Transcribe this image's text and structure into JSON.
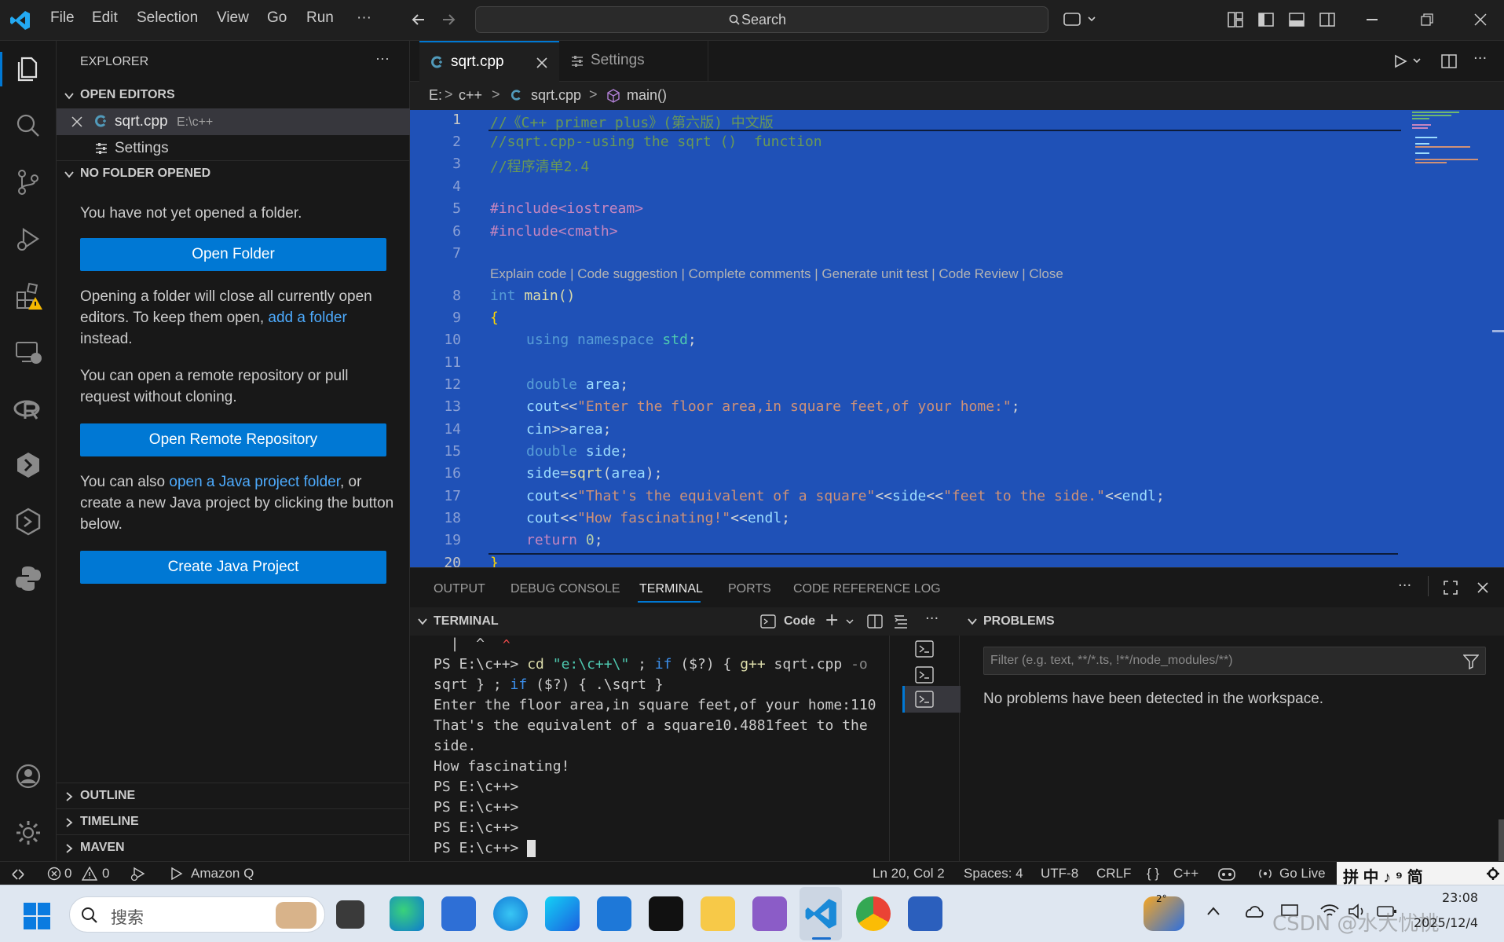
{
  "titlebar": {
    "menu": [
      "File",
      "Edit",
      "Selection",
      "View",
      "Go",
      "Run",
      "···"
    ],
    "search_placeholder": "Search"
  },
  "explorer": {
    "title": "EXPLORER",
    "open_editors": "OPEN EDITORS",
    "editors": [
      {
        "name": "sqrt.cpp",
        "path": "E:\\c++"
      },
      {
        "name": "Settings",
        "path": ""
      }
    ],
    "no_folder": "NO FOLDER OPENED",
    "not_opened": "You have not yet opened a folder.",
    "open_folder_btn": "Open Folder",
    "closing_text_1": "Opening a folder will close all currently open editors. To keep them open, ",
    "add_folder_link": "add a folder",
    "closing_text_2": " instead.",
    "remote_text": "You can open a remote repository or pull request without cloning.",
    "open_remote_btn": "Open Remote Repository",
    "java_text_1": "You can also ",
    "java_link": "open a Java project folder",
    "java_text_2": ", or create a new Java project by clicking the button below.",
    "create_java_btn": "Create Java Project",
    "outline": "OUTLINE",
    "timeline": "TIMELINE",
    "maven": "MAVEN"
  },
  "tabs": [
    {
      "label": "sqrt.cpp"
    },
    {
      "label": "Settings"
    }
  ],
  "breadcrumb": [
    "E:",
    "c++",
    "sqrt.cpp",
    "main()"
  ],
  "codelens": "Explain code | Code suggestion | Complete comments | Generate unit test | Code Review | Close",
  "line_numbers": [
    "1",
    "2",
    "3",
    "4",
    "5",
    "6",
    "7",
    "8",
    "9",
    "10",
    "11",
    "12",
    "13",
    "14",
    "15",
    "16",
    "17",
    "18",
    "19",
    "20"
  ],
  "code": {
    "l1": "//《C++ primer plus》(第六版) 中文版",
    "l2": "//sqrt.cpp--using the sqrt ()  function",
    "l3": "//程序清单2.4",
    "l5": "#include<iostream>",
    "l6": "#include<cmath>",
    "l8a": "int",
    "l8b": " main()",
    "l9": "{",
    "l10a": "using",
    "l10b": " namespace",
    "l10c": " std",
    "l10d": ";",
    "l12a": "double",
    "l12b": " area",
    "l12c": ";",
    "l13a": "cout",
    "l13b": "<<",
    "l13c": "\"Enter the floor area,in square feet,of your home:\"",
    "l13d": ";",
    "l14a": "cin",
    "l14b": ">>",
    "l14c": "area",
    "l14d": ";",
    "l15a": "double",
    "l15b": " side",
    "l15c": ";",
    "l16a": "side",
    "l16b": "=",
    "l16c": "sqrt",
    "l16d": "(",
    "l16e": "area",
    "l16f": ");",
    "l17a": "cout",
    "l17b": "<<",
    "l17c": "\"That's the equivalent of a square\"",
    "l17d": "<<",
    "l17e": "side",
    "l17f": "<<",
    "l17g": "\"feet to the side.\"",
    "l17h": "<<",
    "l17i": "endl",
    "l17j": ";",
    "l18a": "cout",
    "l18b": "<<",
    "l18c": "\"How fascinating!\"",
    "l18d": "<<",
    "l18e": "endl",
    "l18f": ";",
    "l19a": "return",
    "l19b": " 0",
    "l19c": ";",
    "l20": "}"
  },
  "panel": {
    "tabs": [
      "OUTPUT",
      "DEBUG CONSOLE",
      "TERMINAL",
      "PORTS",
      "CODE REFERENCE LOG"
    ],
    "terminal_title": "TERMINAL",
    "terminal_profile": "Code",
    "problems_title": "PROBLEMS",
    "filter_placeholder": "Filter (e.g. text, **/*.ts, !**/node_modules/**)",
    "no_problems": "No problems have been detected in the workspace.",
    "terminal_lines": {
      "caret": "  |  ^",
      "cmd_prompt": "PS E:\\c++> ",
      "cmd_cd": "cd",
      "cmd_path": " \"e:\\c++\\\"",
      "cmd_rest1": " ; ",
      "cmd_if": "if",
      "cmd_rest2": " ($?) { ",
      "cmd_gpp": "g++",
      "cmd_rest3": " sqrt.cpp ",
      "cmd_o": "-o",
      "cmd2_a": "sqrt } ; ",
      "cmd2_if": "if",
      "cmd2_b": " ($?) { .\\sqrt }",
      "out1": "Enter the floor area,in square feet,of your home:110",
      "out2": "That's the equivalent of a square10.4881feet to the",
      "out3": "side.",
      "out4": "How fascinating!",
      "ps1": "PS E:\\c++>",
      "ps2": "PS E:\\c++>",
      "ps3": "PS E:\\c++>",
      "ps4": "PS E:\\c++> "
    }
  },
  "status": {
    "errors": "0",
    "warnings": "0",
    "amazon_q": "Amazon Q",
    "position": "Ln 20, Col 2",
    "spaces": "Spaces: 4",
    "encoding": "UTF-8",
    "eol": "CRLF",
    "language": "C++",
    "golive": "Go Live",
    "ime": "拼 中 ♪ ⁹ 简"
  },
  "taskbar": {
    "search": "搜索",
    "time": "23:08",
    "date": "2025/12/4",
    "watermark": "CSDN @水大忧桃",
    "weather": "2°"
  },
  "colors": {
    "accent": "#0078d4",
    "selection": "#1f51b7",
    "link": "#4daafc"
  }
}
